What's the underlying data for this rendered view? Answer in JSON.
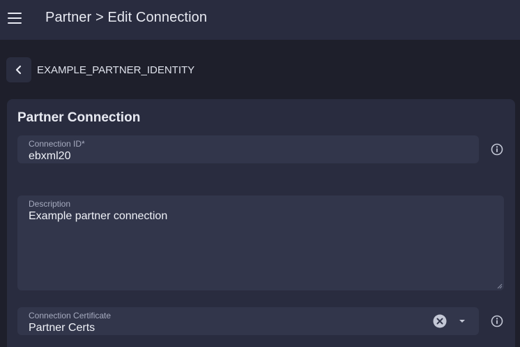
{
  "header": {
    "title": "Partner > Edit Connection",
    "menu_icon": "hamburger-menu-icon"
  },
  "subheader": {
    "back_icon": "chevron-left-icon",
    "identity": "EXAMPLE_PARTNER_IDENTITY"
  },
  "card": {
    "title": "Partner Connection",
    "connection_id": {
      "label": "Connection ID*",
      "value": "ebxml20",
      "info_icon": "info-icon"
    },
    "description": {
      "label": "Description",
      "value": "Example partner connection"
    },
    "certificate": {
      "label": "Connection Certificate",
      "value": "Partner Certs",
      "clear_icon": "clear-icon",
      "dropdown_icon": "dropdown-arrow-icon",
      "info_icon": "info-icon"
    }
  },
  "colors": {
    "page_bg": "#1e1f2b",
    "topbar_bg": "#292c3f",
    "card_bg": "#292c3f",
    "field_bg": "#32364b",
    "label": "#a6abbf",
    "text": "#e8eaf2"
  }
}
